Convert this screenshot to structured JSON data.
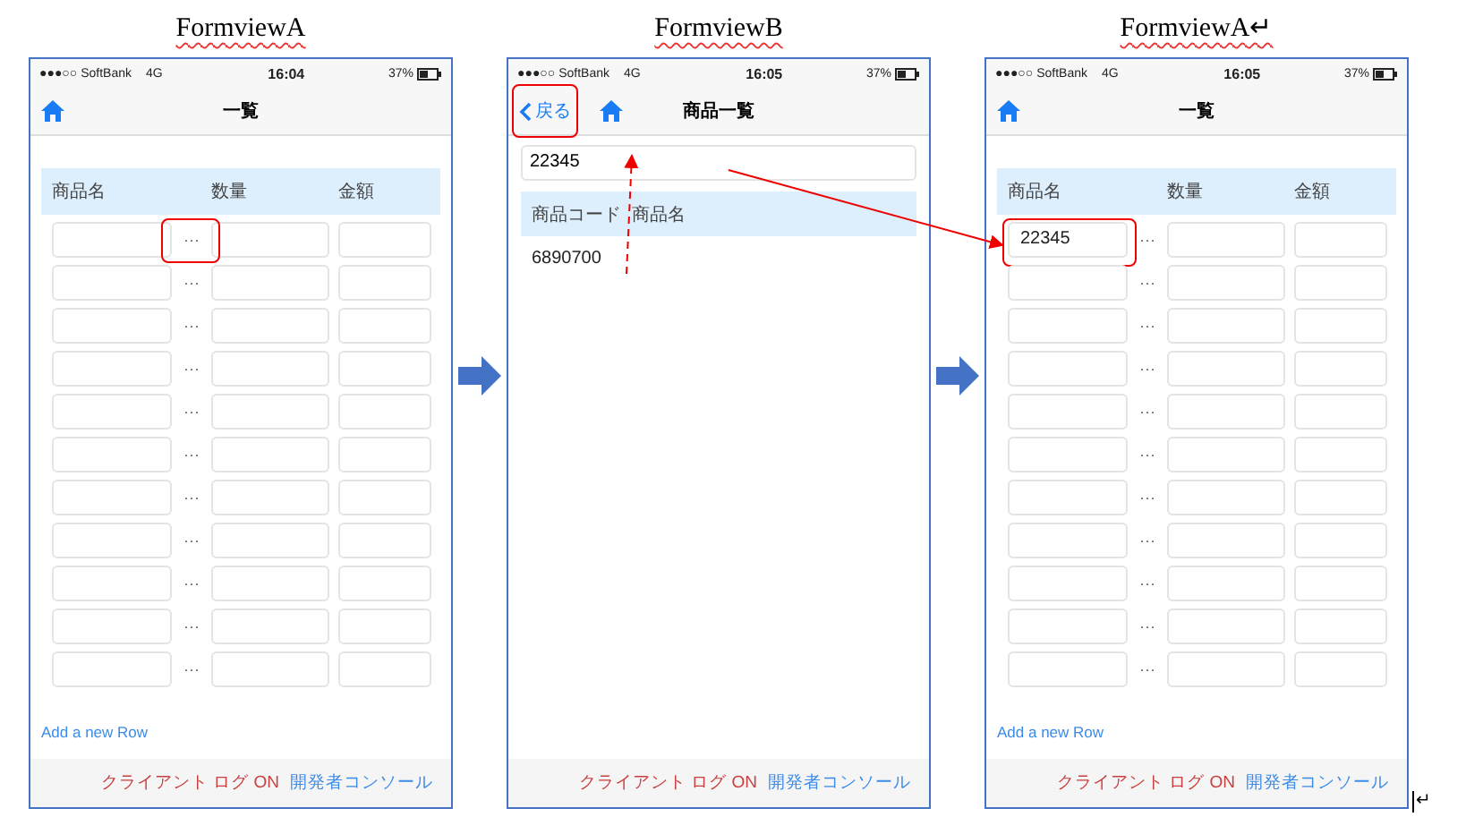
{
  "screens": [
    {
      "caption": "FormviewA",
      "kind": "list",
      "status": {
        "carrier": "●●●○○ SoftBank",
        "network": "4G",
        "time": "16:04",
        "battery": "37%"
      },
      "nav": {
        "title": "一覧"
      },
      "table": {
        "columns": [
          "商品名",
          "数量",
          "金額"
        ],
        "rows": [
          {
            "more": "···",
            "more_framed": true
          },
          {
            "more": "···"
          },
          {
            "more": "···"
          },
          {
            "more": "···"
          },
          {
            "more": "···"
          },
          {
            "more": "···"
          },
          {
            "more": "···"
          },
          {
            "more": "···"
          },
          {
            "more": "···"
          },
          {
            "more": "···"
          },
          {
            "more": "···"
          }
        ]
      },
      "add_row": "Add a new Row",
      "footer": {
        "log": "クライアント ログ ON",
        "console": "開発者コンソール"
      }
    },
    {
      "caption": "FormviewB",
      "kind": "search",
      "status": {
        "carrier": "●●●○○ SoftBank",
        "network": "4G",
        "time": "16:05",
        "battery": "37%"
      },
      "nav": {
        "back": "戻る",
        "back_framed": true,
        "title": "商品一覧"
      },
      "search": {
        "value": "22345"
      },
      "table": {
        "columns": [
          "商品コード",
          "商品名"
        ],
        "rows": [
          {
            "code": "6890700"
          }
        ]
      },
      "footer": {
        "log": "クライアント ログ ON",
        "console": "開発者コンソール"
      }
    },
    {
      "caption": "FormviewA↵",
      "kind": "list",
      "status": {
        "carrier": "●●●○○ SoftBank",
        "network": "4G",
        "time": "16:05",
        "battery": "37%"
      },
      "nav": {
        "title": "一覧"
      },
      "table": {
        "columns": [
          "商品名",
          "数量",
          "金額"
        ],
        "rows": [
          {
            "name": "22345",
            "name_framed": true,
            "more": "···"
          },
          {
            "more": "···"
          },
          {
            "more": "···"
          },
          {
            "more": "···"
          },
          {
            "more": "···"
          },
          {
            "more": "···"
          },
          {
            "more": "···"
          },
          {
            "more": "···"
          },
          {
            "more": "···"
          },
          {
            "more": "···"
          },
          {
            "more": "···"
          }
        ]
      },
      "add_row": "Add a new Row",
      "footer": {
        "log": "クライアント ログ ON",
        "console": "開発者コンソール"
      }
    }
  ],
  "end_mark": "↵"
}
